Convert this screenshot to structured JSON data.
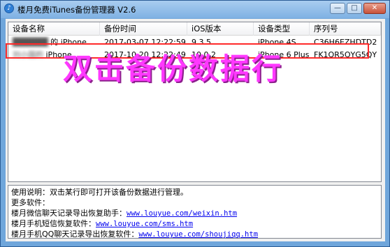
{
  "window": {
    "title": "楼月免费iTunes备份管理器 V2.6",
    "buttons": {
      "minimize": "—",
      "restore": "□",
      "close": "✕"
    }
  },
  "list": {
    "columns": [
      "设备名称",
      "备份时间",
      "iOS版本",
      "设备类型",
      "序列号"
    ],
    "rows": [
      {
        "name_blur": "██████",
        "name_suffix": "的 iPhone",
        "time": "2017-03-07 12:22:59",
        "ios": "9.3.5",
        "type": "iPhone 4S",
        "serial": "C36H6EZHDTD2"
      },
      {
        "name_blur": "刘小国的",
        "name_suffix": "iPhone",
        "time": "2017-10-20 12:22:49",
        "ios": "10.0.2",
        "type": "iPhone 6 Plus",
        "serial": "FK1QR5QYG5QY"
      }
    ]
  },
  "annotation": {
    "text": "双击备份数据行",
    "color": "#ff38ff",
    "box_color": "#ff2a2a"
  },
  "info": {
    "usage": "使用说明：双击某行即可打开该备份数据进行管理。",
    "more": "更多软件：",
    "links": [
      {
        "label": "楼月微信聊天记录导出恢复助手：",
        "url": "www.louyue.com/weixin.htm"
      },
      {
        "label": "楼月手机短信恢复软件：",
        "url": "www.louyue.com/sms.htm"
      },
      {
        "label": "楼月手机QQ聊天记录导出恢复软件：",
        "url": "www.louyue.com/shoujiqq.htm"
      }
    ]
  }
}
